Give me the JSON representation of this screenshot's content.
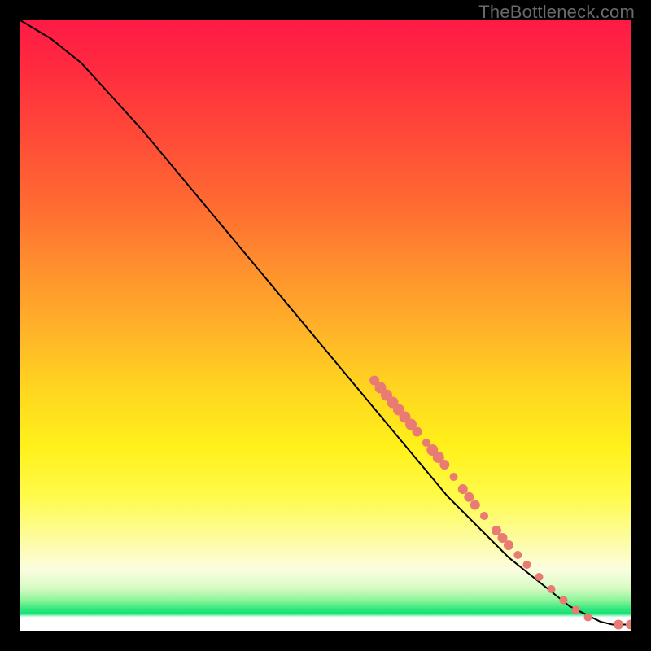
{
  "watermark": "TheBottleneck.com",
  "chart_data": {
    "type": "line",
    "title": "",
    "xlabel": "",
    "ylabel": "",
    "xlim": [
      0,
      100
    ],
    "ylim": [
      0,
      100
    ],
    "curve": {
      "name": "bottleneck-curve",
      "points": [
        {
          "x": 0,
          "y": 100
        },
        {
          "x": 5,
          "y": 97
        },
        {
          "x": 10,
          "y": 93
        },
        {
          "x": 20,
          "y": 82
        },
        {
          "x": 30,
          "y": 70
        },
        {
          "x": 40,
          "y": 58
        },
        {
          "x": 50,
          "y": 46
        },
        {
          "x": 60,
          "y": 34
        },
        {
          "x": 70,
          "y": 22
        },
        {
          "x": 80,
          "y": 12
        },
        {
          "x": 90,
          "y": 4
        },
        {
          "x": 95,
          "y": 1.5
        },
        {
          "x": 97,
          "y": 1
        },
        {
          "x": 100,
          "y": 1
        }
      ]
    },
    "scatter": {
      "name": "highlight-points",
      "color": "#e97b73",
      "points": [
        {
          "x": 58,
          "y": 41.0,
          "r": 6
        },
        {
          "x": 59,
          "y": 39.8,
          "r": 7
        },
        {
          "x": 60,
          "y": 38.6,
          "r": 7
        },
        {
          "x": 61,
          "y": 37.4,
          "r": 7
        },
        {
          "x": 62,
          "y": 36.2,
          "r": 7
        },
        {
          "x": 63,
          "y": 35.0,
          "r": 7
        },
        {
          "x": 64,
          "y": 33.8,
          "r": 7
        },
        {
          "x": 65,
          "y": 32.6,
          "r": 6
        },
        {
          "x": 66.5,
          "y": 30.8,
          "r": 5
        },
        {
          "x": 67.5,
          "y": 29.6,
          "r": 7
        },
        {
          "x": 68.5,
          "y": 28.4,
          "r": 7
        },
        {
          "x": 69.5,
          "y": 27.2,
          "r": 6
        },
        {
          "x": 71,
          "y": 25.2,
          "r": 5
        },
        {
          "x": 72.5,
          "y": 23.2,
          "r": 6
        },
        {
          "x": 73.5,
          "y": 21.9,
          "r": 6
        },
        {
          "x": 74.5,
          "y": 20.6,
          "r": 6
        },
        {
          "x": 76,
          "y": 18.8,
          "r": 5
        },
        {
          "x": 78,
          "y": 16.4,
          "r": 6
        },
        {
          "x": 79,
          "y": 15.2,
          "r": 6
        },
        {
          "x": 80,
          "y": 14.0,
          "r": 6
        },
        {
          "x": 81.5,
          "y": 12.4,
          "r": 5
        },
        {
          "x": 83,
          "y": 10.8,
          "r": 5
        },
        {
          "x": 85,
          "y": 8.8,
          "r": 5
        },
        {
          "x": 87,
          "y": 6.8,
          "r": 5
        },
        {
          "x": 89,
          "y": 5.0,
          "r": 5
        },
        {
          "x": 91,
          "y": 3.4,
          "r": 5
        },
        {
          "x": 93,
          "y": 2.2,
          "r": 5
        },
        {
          "x": 98,
          "y": 1.0,
          "r": 6
        },
        {
          "x": 100,
          "y": 1.0,
          "r": 6
        }
      ]
    },
    "background_gradient_stops": [
      {
        "pos": 0,
        "color": "#ff1a46"
      },
      {
        "pos": 0.3,
        "color": "#ff6a32"
      },
      {
        "pos": 0.6,
        "color": "#ffd420"
      },
      {
        "pos": 0.85,
        "color": "#fdfca0"
      },
      {
        "pos": 0.96,
        "color": "#30e77e"
      },
      {
        "pos": 1.0,
        "color": "#ffffff"
      }
    ]
  }
}
